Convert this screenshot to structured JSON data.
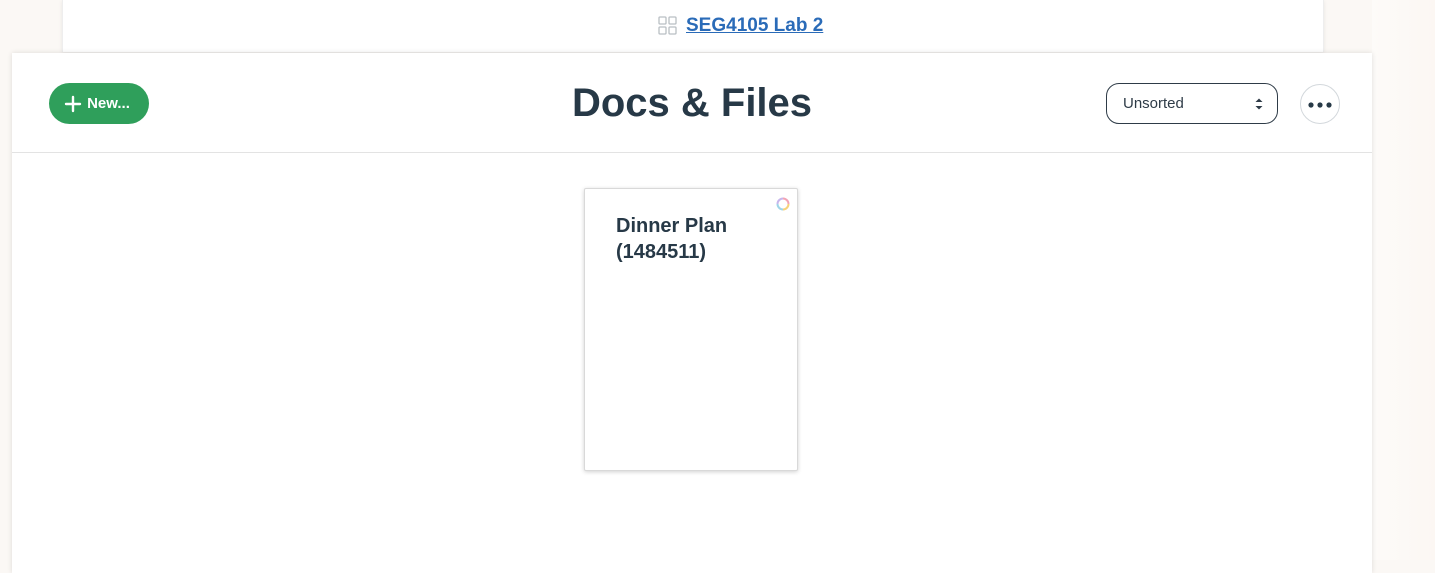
{
  "project": {
    "link_label": "SEG4105 Lab 2",
    "icon": "grid-icon"
  },
  "header": {
    "title": "Docs & Files",
    "new_button_label": "New...",
    "new_button_icon": "plus-icon",
    "sort_select": {
      "selected": "Unsorted",
      "icon": "sort-arrows-icon"
    },
    "more_button_icon": "ellipsis-icon"
  },
  "documents": [
    {
      "title": "Dinner Plan (1484511)",
      "status_icon": "loading-ring-icon"
    }
  ],
  "colors": {
    "accent_green": "#2f9f5b",
    "link_blue": "#2a6bb8",
    "text_dark": "#273947"
  }
}
